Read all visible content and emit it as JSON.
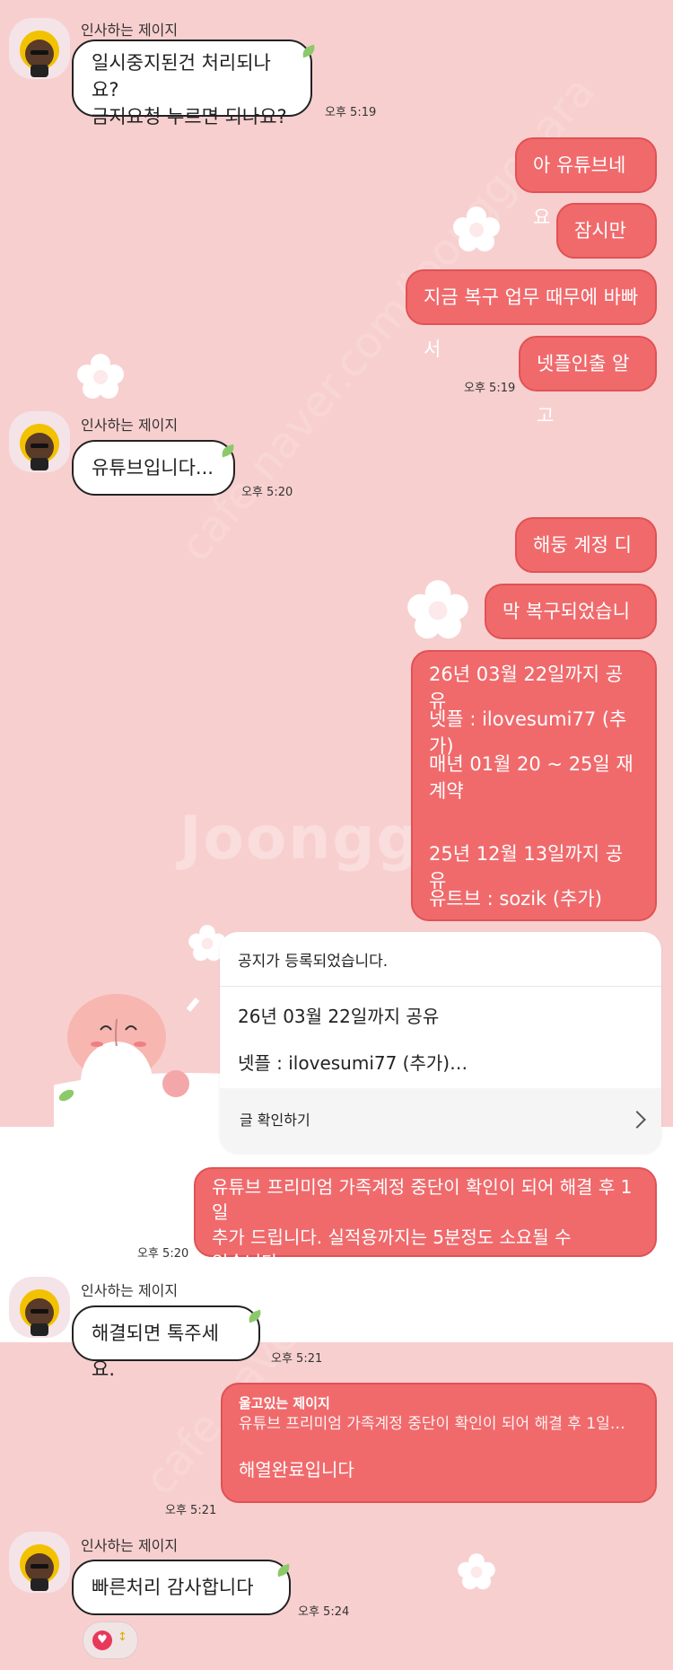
{
  "watermark": {
    "brand": "Joonggonara",
    "url": "cafe.naver.com/joonggonara"
  },
  "messages": {
    "m1": {
      "sender": "인사하는 제이지",
      "lines": [
        "일시중지된건 처리되나요?",
        "금지요청 누르면 되나요?"
      ],
      "time": "오후 5:19"
    },
    "m2": {
      "lines": [
        "아 유튜브네요",
        "잠시만요",
        "지금 복구 업무 때무에 바빠서",
        "넷플인출 알고"
      ],
      "time": "오후 5:19"
    },
    "m3": {
      "sender": "인사하는 제이지",
      "text": "유튜브입니다...",
      "time": "오후 5:20"
    },
    "m4": {
      "lines": [
        "해둥 계정 디그",
        "막 복구되었습니다"
      ]
    },
    "m5": {
      "lines": [
        "26년 03월 22일까지 공유",
        "넷플 : ilovesumi77 (추가)",
        "매년 01월 20 ~ 25일 재계약",
        "",
        "25년 12월 13일까지 공유",
        "유트브 : sozik (추가)"
      ]
    },
    "notice": {
      "header": "공지가 등록되었습니다.",
      "line1": "26년 03월 22일까지 공유",
      "line2": "넷플 : ilovesumi77 (추가)…",
      "footer": "글 확인하기"
    },
    "m6": {
      "lines": [
        "유튜브 프리미엄 가족계정 중단이 확인이 되어 해결 후 1일",
        "추가 드립니다. 실적용까지는 5분정도 소요될 수",
        "있습니다."
      ],
      "time": "오후 5:20"
    },
    "m7": {
      "sender": "인사하는 제이지",
      "text": "해결되면 톡주세요.",
      "time": "오후 5:21"
    },
    "m8": {
      "reply_to": "울고있는 제이지",
      "quote": "유튜브 프리미엄 가족계정 중단이 확인이 되어 해결 후 1일…",
      "text": "해열완료입니다",
      "time": "오후 5:21"
    },
    "m9": {
      "sender": "인사하는 제이지",
      "text": "빠른처리 감사합니다 ~",
      "time": "오후 5:24"
    }
  },
  "reaction": {
    "icon": "heart-icon",
    "count_icon": "up-down-icon"
  },
  "colors": {
    "background": "#f8cfcf",
    "sent_bubble": "#f06a6c",
    "received_bubble": "#ffffff"
  }
}
